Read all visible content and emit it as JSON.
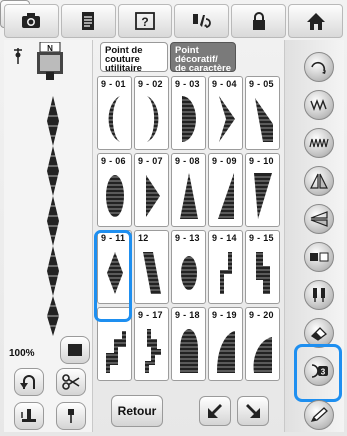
{
  "top_bar": {
    "buttons": [
      {
        "icon": "camera-icon"
      },
      {
        "icon": "document-icon"
      },
      {
        "icon": "help-icon",
        "label": "?"
      },
      {
        "icon": "needle-thread-icon"
      },
      {
        "icon": "lock-icon"
      },
      {
        "icon": "home-icon"
      }
    ]
  },
  "left_panel": {
    "presser_foot_label": "N",
    "zoom_text": "100%"
  },
  "tabs": {
    "utility_label": "Point de couture utilitaire",
    "decorative_label": "Point décoratif/ de caractère"
  },
  "stitches": [
    {
      "id": "9 - 01",
      "shape": "crescent-left"
    },
    {
      "id": "9 - 02",
      "shape": "crescent-right"
    },
    {
      "id": "9 - 03",
      "shape": "half-oval-right"
    },
    {
      "id": "9 - 04",
      "shape": "chevron-right"
    },
    {
      "id": "9 - 05",
      "shape": "wedge-down"
    },
    {
      "id": "9 - 06",
      "shape": "oval"
    },
    {
      "id": "9 - 07",
      "shape": "triangle-right"
    },
    {
      "id": "9 - 08",
      "shape": "triangle-up"
    },
    {
      "id": "9 - 09",
      "shape": "triangle-up-right"
    },
    {
      "id": "9 - 10",
      "shape": "wedge-top"
    },
    {
      "id": "9 - 11",
      "shape": "diamond"
    },
    {
      "id": "12",
      "shape": "parallelogram"
    },
    {
      "id": "9 - 13",
      "shape": "oval-small"
    },
    {
      "id": "9 - 14",
      "shape": "zigzag"
    },
    {
      "id": "9 - 15",
      "shape": "steps"
    },
    {
      "id": "",
      "shape": "steps-small"
    },
    {
      "id": "9 - 17",
      "shape": "dots-chevron"
    },
    {
      "id": "9 - 18",
      "shape": "dome"
    },
    {
      "id": "9 - 19",
      "shape": "quarter-curve"
    },
    {
      "id": "9 - 20",
      "shape": "quarter-curve-2"
    }
  ],
  "bottom": {
    "retour_label": "Retour"
  },
  "right_panel": {
    "buttons": [
      {
        "icon": "undo-spiral-icon"
      },
      {
        "icon": "elongation-icon"
      },
      {
        "icon": "density-icon"
      },
      {
        "icon": "mirror-vertical-icon"
      },
      {
        "icon": "mirror-horizontal-icon"
      },
      {
        "icon": "pattern-toggle-icon"
      },
      {
        "icon": "twin-needle-icon"
      },
      {
        "icon": "eraser-icon"
      },
      {
        "icon": "spacing-icon",
        "label": "3"
      },
      {
        "icon": "pen-icon"
      }
    ]
  },
  "colors": {
    "highlight": "#1e8ff0",
    "stitch_fill": "#222222"
  }
}
